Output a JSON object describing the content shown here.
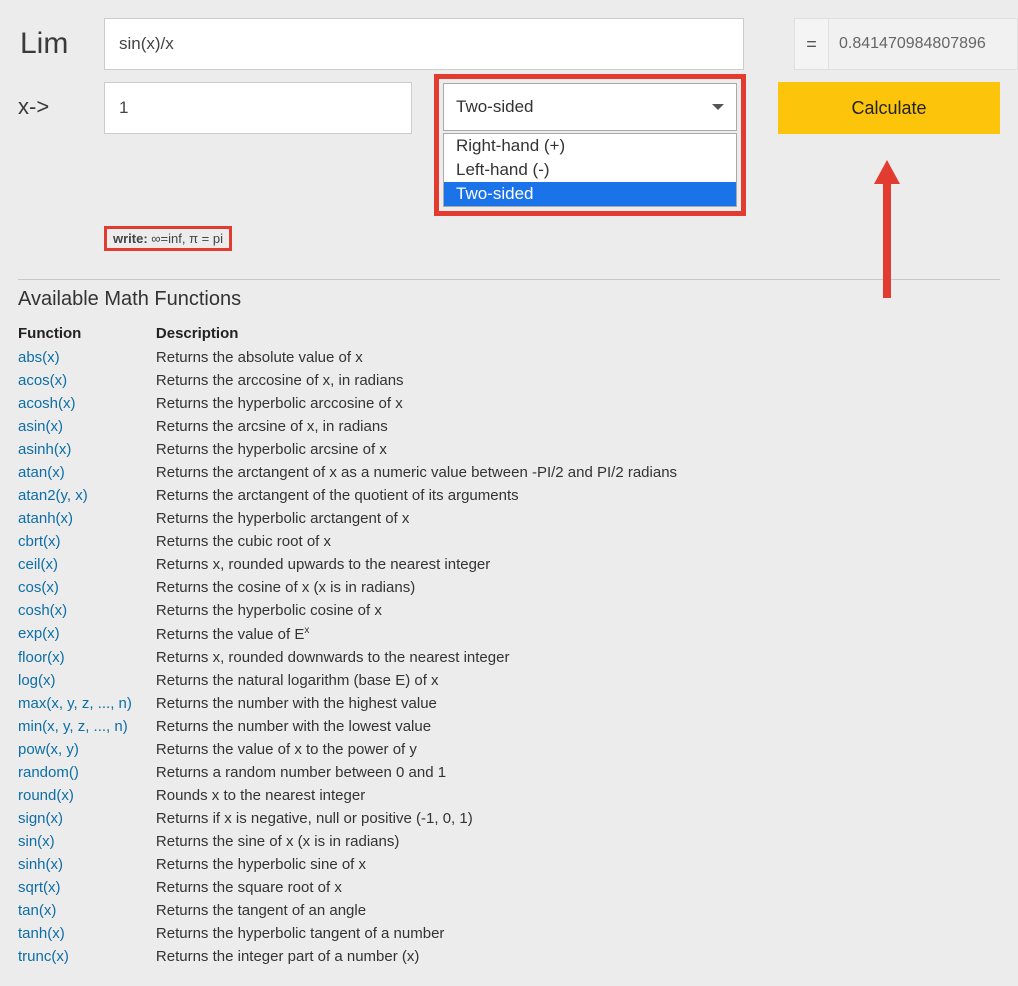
{
  "labels": {
    "lim": "Lim",
    "xto": "x->",
    "eq": "=",
    "calculate": "Calculate",
    "hint_prefix": "write:",
    "hint_rest": " ∞=inf, π = pi",
    "functions_title": "Available Math Functions",
    "th_function": "Function",
    "th_description": "Description"
  },
  "inputs": {
    "expression": "sin(x)/x",
    "to_value": "1",
    "result": "0.841470984807896"
  },
  "select": {
    "current": "Two-sided",
    "options": [
      "Right-hand (+)",
      "Left-hand (-)",
      "Two-sided"
    ],
    "highlighted_index": 2
  },
  "functions": [
    {
      "fn": "abs(x)",
      "desc": "Returns the absolute value of x"
    },
    {
      "fn": "acos(x)",
      "desc": "Returns the arccosine of x, in radians"
    },
    {
      "fn": "acosh(x)",
      "desc": "Returns the hyperbolic arccosine of x"
    },
    {
      "fn": "asin(x)",
      "desc": "Returns the arcsine of x, in radians"
    },
    {
      "fn": "asinh(x)",
      "desc": "Returns the hyperbolic arcsine of x"
    },
    {
      "fn": "atan(x)",
      "desc": "Returns the arctangent of x as a numeric value between -PI/2 and PI/2 radians"
    },
    {
      "fn": "atan2(y, x)",
      "desc": "Returns the arctangent of the quotient of its arguments"
    },
    {
      "fn": "atanh(x)",
      "desc": "Returns the hyperbolic arctangent of x"
    },
    {
      "fn": "cbrt(x)",
      "desc": "Returns the cubic root of x"
    },
    {
      "fn": "ceil(x)",
      "desc": "Returns x, rounded upwards to the nearest integer"
    },
    {
      "fn": "cos(x)",
      "desc": "Returns the cosine of x (x is in radians)"
    },
    {
      "fn": "cosh(x)",
      "desc": "Returns the hyperbolic cosine of x"
    },
    {
      "fn": "exp(x)",
      "desc": "Returns the value of E^x"
    },
    {
      "fn": "floor(x)",
      "desc": "Returns x, rounded downwards to the nearest integer"
    },
    {
      "fn": "log(x)",
      "desc": "Returns the natural logarithm (base E) of x"
    },
    {
      "fn": "max(x, y, z, ..., n)",
      "desc": "Returns the number with the highest value"
    },
    {
      "fn": "min(x, y, z, ..., n)",
      "desc": "Returns the number with the lowest value"
    },
    {
      "fn": "pow(x, y)",
      "desc": "Returns the value of x to the power of y"
    },
    {
      "fn": "random()",
      "desc": "Returns a random number between 0 and 1"
    },
    {
      "fn": "round(x)",
      "desc": "Rounds x to the nearest integer"
    },
    {
      "fn": "sign(x)",
      "desc": "Returns if x is negative, null or positive (-1, 0, 1)"
    },
    {
      "fn": "sin(x)",
      "desc": "Returns the sine of x (x is in radians)"
    },
    {
      "fn": "sinh(x)",
      "desc": "Returns the hyperbolic sine of x"
    },
    {
      "fn": "sqrt(x)",
      "desc": "Returns the square root of x"
    },
    {
      "fn": "tan(x)",
      "desc": "Returns the tangent of an angle"
    },
    {
      "fn": "tanh(x)",
      "desc": "Returns the hyperbolic tangent of a number"
    },
    {
      "fn": "trunc(x)",
      "desc": "Returns the integer part of a number (x)"
    }
  ]
}
